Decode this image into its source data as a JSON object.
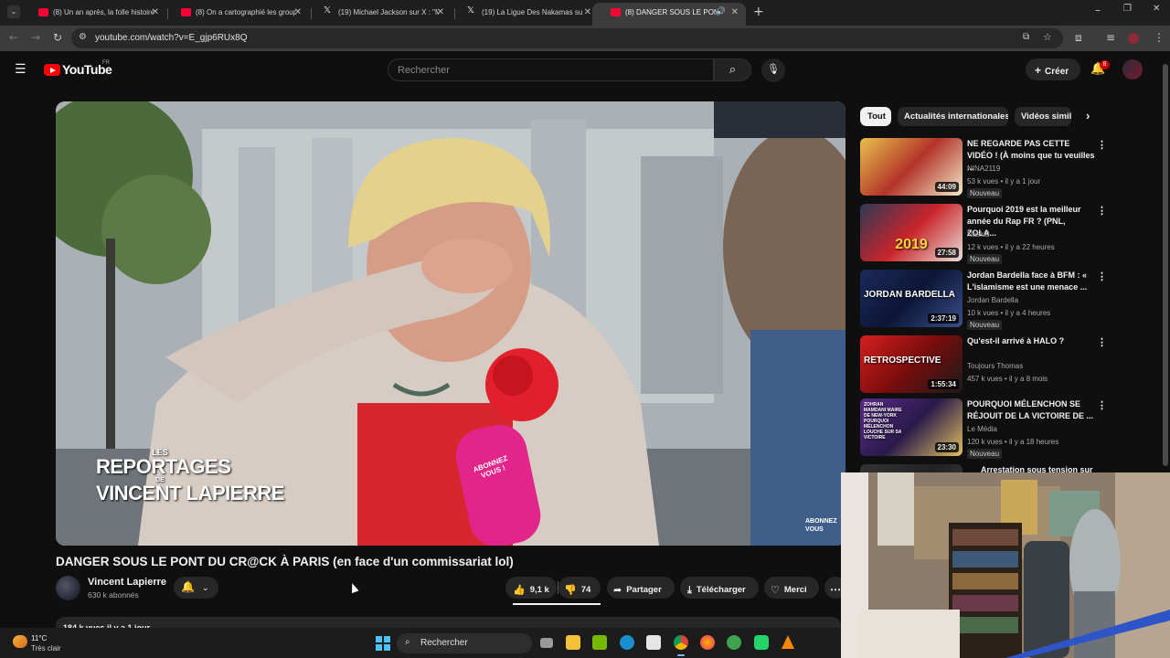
{
  "browser": {
    "tabs": [
      {
        "title": "(8) Un an après, la folle histoire",
        "icon": "youtube-icon"
      },
      {
        "title": "(8) On a cartographié les group",
        "icon": "youtube-icon"
      },
      {
        "title": "(19) Michael Jackson sur X : \"M",
        "icon": "x-icon"
      },
      {
        "title": "(19) La Ligue Des Nakamas sur",
        "icon": "x-icon"
      },
      {
        "title": "(8) DANGER SOUS LE PONT",
        "icon": "youtube-icon"
      }
    ],
    "new_tab": "+",
    "url": "youtube.com/watch?v=E_gjp6RUx8Q"
  },
  "youtube": {
    "logo": "YouTube",
    "country": "FR",
    "search_placeholder": "Rechercher",
    "create_label": "Créer",
    "notification_count": "8"
  },
  "video": {
    "overlay_series": "LES",
    "overlay_title1": "REPORTAGES",
    "overlay_de": "DE",
    "overlay_title2": "VINCENT LAPIERRE",
    "overlay_corner": "ABONNEZ VOUS",
    "mic_label": "ABONNEZ VOUS !",
    "title": "DANGER SOUS LE PONT DU CR@CK À PARIS (en face d'un commissariat lol)",
    "channel": "Vincent Lapierre",
    "subscribers": "630 k abonnés",
    "likes": "9,1 k",
    "dislikes": "74",
    "share_label": "Partager",
    "download_label": "Télécharger",
    "thanks_label": "Merci",
    "views_line": "184 k vues  il y a 1 jour"
  },
  "chips": [
    "Tout",
    "Actualités internationales",
    "Vidéos simila"
  ],
  "recommendations": [
    {
      "title": "NE REGARDE PAS CETTE VIDÉO ! (À moins que tu veuilles ...",
      "channel": "NINA2119",
      "meta": "53 k vues • il y a 1 jour",
      "badge": "Nouveau",
      "duration": "44:09",
      "thumb_colors": [
        "#e8c14a",
        "#b3342a",
        "#f3e9c9"
      ],
      "thumb_text": ""
    },
    {
      "title": "Pourquoi 2019 est la meilleur année du Rap FR ? (PNL, ZOLA...",
      "channel": "Naskid",
      "meta": "12 k vues • il y a 22 heures",
      "badge": "Nouveau",
      "duration": "27:58",
      "thumb_colors": [
        "#2d3a55",
        "#c9242a",
        "#e8e0d8"
      ],
      "thumb_text": "2019"
    },
    {
      "title": "Jordan Bardella face à BFM : « L'islamisme est une menace ...",
      "channel": "Jordan Bardella",
      "meta": "10 k vues • il y a 4 heures",
      "badge": "Nouveau",
      "duration": "2:37:19",
      "thumb_colors": [
        "#1a2a5a",
        "#0c1636",
        "#3a4f8a"
      ],
      "thumb_text": "JORDAN BARDELLA"
    },
    {
      "title": "Qu'est-il arrivé à HALO ?",
      "channel": "Toujours Thomas",
      "meta": "457 k vues • il y a 8 mois",
      "badge": "",
      "duration": "1:55:34",
      "thumb_colors": [
        "#d61f1f",
        "#7a0d0d",
        "#1a1a1a"
      ],
      "thumb_text": "RETROSPECTIVE"
    },
    {
      "title": "POURQUOI MÉLENCHON SE RÉJOUIT DE LA VICTOIRE DE ...",
      "channel": "Le Média",
      "meta": "120 k vues • il y a 18 heures",
      "badge": "Nouveau",
      "duration": "23:30",
      "thumb_colors": [
        "#5b2a8a",
        "#2a1a4a",
        "#e0c060"
      ],
      "thumb_text": "ZOHRAN MAMDANI MAIRE DE NEW-YORK POURQUOI MÉLENCHON LOUCHE SUR SA VICTOIRE"
    },
    {
      "title": "Arrestation sous tension sur",
      "channel": "",
      "meta": "",
      "badge": "",
      "duration": "",
      "thumb_colors": [
        "#333333",
        "#222222",
        "#444444"
      ],
      "thumb_text": ""
    }
  ],
  "taskbar": {
    "temperature": "11°C",
    "weather": "Très clair",
    "search_label": "Rechercher"
  }
}
